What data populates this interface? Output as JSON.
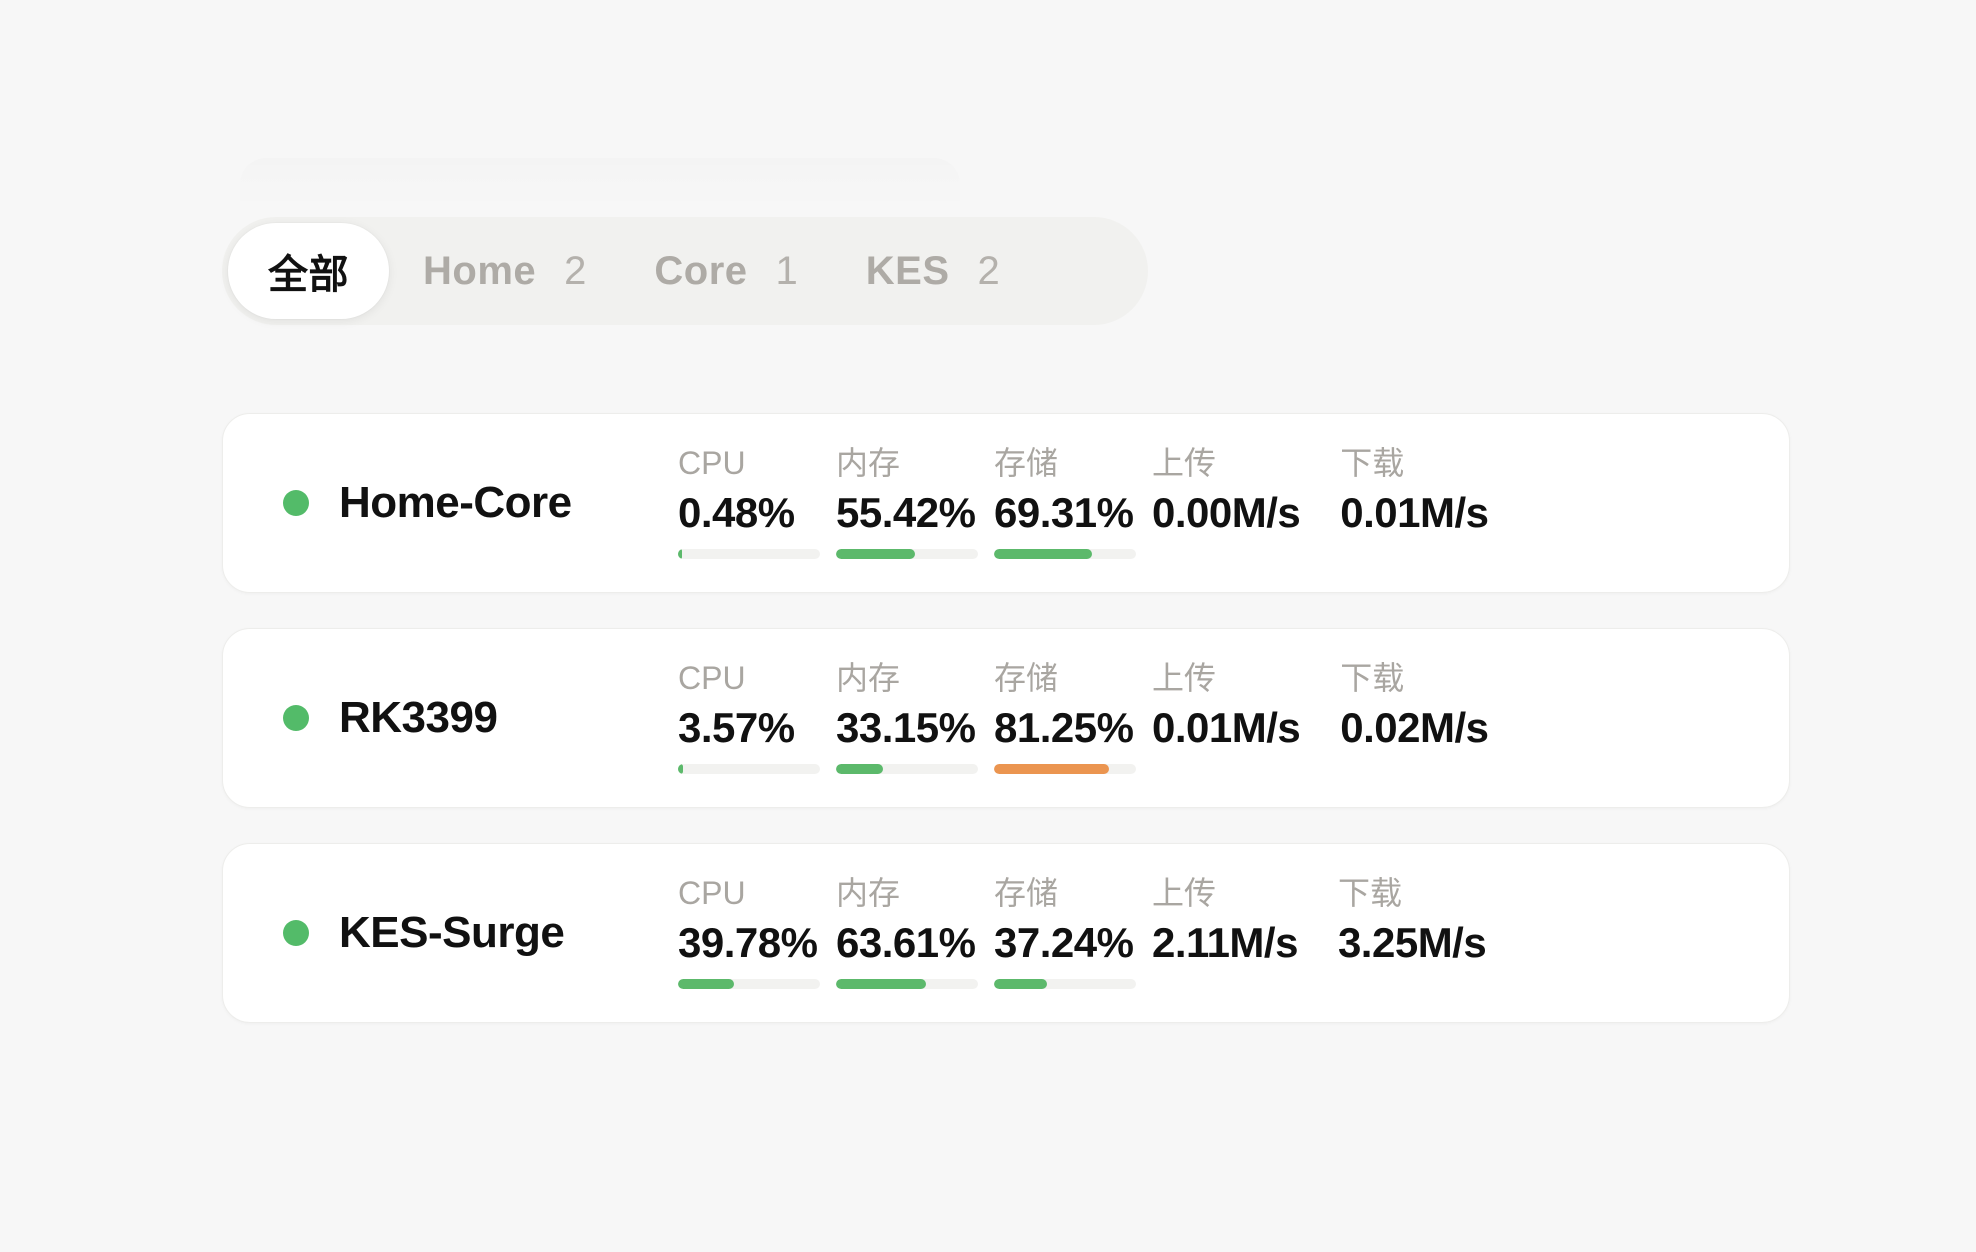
{
  "tabs": [
    {
      "label": "全部",
      "count": "",
      "active": true
    },
    {
      "label": "Home",
      "count": "2",
      "active": false
    },
    {
      "label": "Core",
      "count": "1",
      "active": false
    },
    {
      "label": "KES",
      "count": "2",
      "active": false
    }
  ],
  "metric_labels": {
    "cpu": "CPU",
    "memory": "内存",
    "storage": "存储",
    "upload": "上传",
    "download": "下载"
  },
  "colors": {
    "status_online": "#53bb69",
    "bar_normal": "#5cb96b",
    "bar_warning": "#eb9550",
    "bar_track": "#f2f2f0",
    "page_bg": "#f7f7f7",
    "tabbar_bg": "#f1f1ef",
    "card_bg": "#ffffff",
    "label_muted": "#a9a6a1",
    "value_text": "#111111"
  },
  "hosts": [
    {
      "name": "Home-Core",
      "status": "online",
      "status_icon": "status-dot-icon",
      "cpu": {
        "value": "0.48%",
        "pct": 0.48,
        "bar_color": "#5cb96b"
      },
      "memory": {
        "value": "55.42%",
        "pct": 55.42,
        "bar_color": "#5cb96b"
      },
      "storage": {
        "value": "69.31%",
        "pct": 69.31,
        "bar_color": "#5cb96b"
      },
      "upload": {
        "value": "0.00M/s"
      },
      "download": {
        "value": "0.01M/s"
      }
    },
    {
      "name": "RK3399",
      "status": "online",
      "status_icon": "status-dot-icon",
      "cpu": {
        "value": "3.57%",
        "pct": 3.57,
        "bar_color": "#5cb96b"
      },
      "memory": {
        "value": "33.15%",
        "pct": 33.15,
        "bar_color": "#5cb96b"
      },
      "storage": {
        "value": "81.25%",
        "pct": 81.25,
        "bar_color": "#eb9550"
      },
      "upload": {
        "value": "0.01M/s"
      },
      "download": {
        "value": "0.02M/s"
      }
    },
    {
      "name": "KES-Surge",
      "status": "online",
      "status_icon": "status-dot-icon",
      "cpu": {
        "value": "39.78%",
        "pct": 39.78,
        "bar_color": "#5cb96b"
      },
      "memory": {
        "value": "63.61%",
        "pct": 63.61,
        "bar_color": "#5cb96b"
      },
      "storage": {
        "value": "37.24%",
        "pct": 37.24,
        "bar_color": "#5cb96b"
      },
      "upload": {
        "value": "2.11M/s"
      },
      "download": {
        "value": "3.25M/s"
      }
    }
  ]
}
